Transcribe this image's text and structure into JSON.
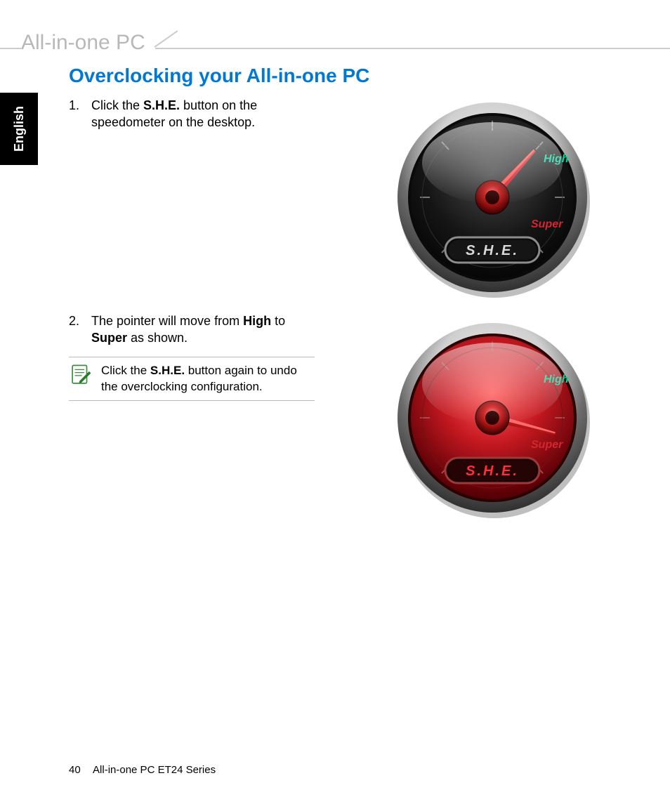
{
  "header": {
    "title": "All-in-one PC"
  },
  "lang_tab": "English",
  "section": {
    "title": "Overclocking your All-in-one PC"
  },
  "steps": [
    {
      "num": "1.",
      "pre": "Click the ",
      "bold1": "S.H.E.",
      "post": " button on the speedometer on the desktop."
    },
    {
      "num": "2.",
      "pre": "The pointer will move from ",
      "bold1": "High",
      "mid": " to ",
      "bold2": "Super",
      "post": " as shown."
    }
  ],
  "note": {
    "pre": "Click the ",
    "bold": "S.H.E.",
    "post": " button again to undo the overclocking configuration."
  },
  "gauge": {
    "label_high": "High",
    "label_super": "Super",
    "button": "S.H.E."
  },
  "footer": {
    "page": "40",
    "text": "All-in-one PC ET24 Series"
  }
}
